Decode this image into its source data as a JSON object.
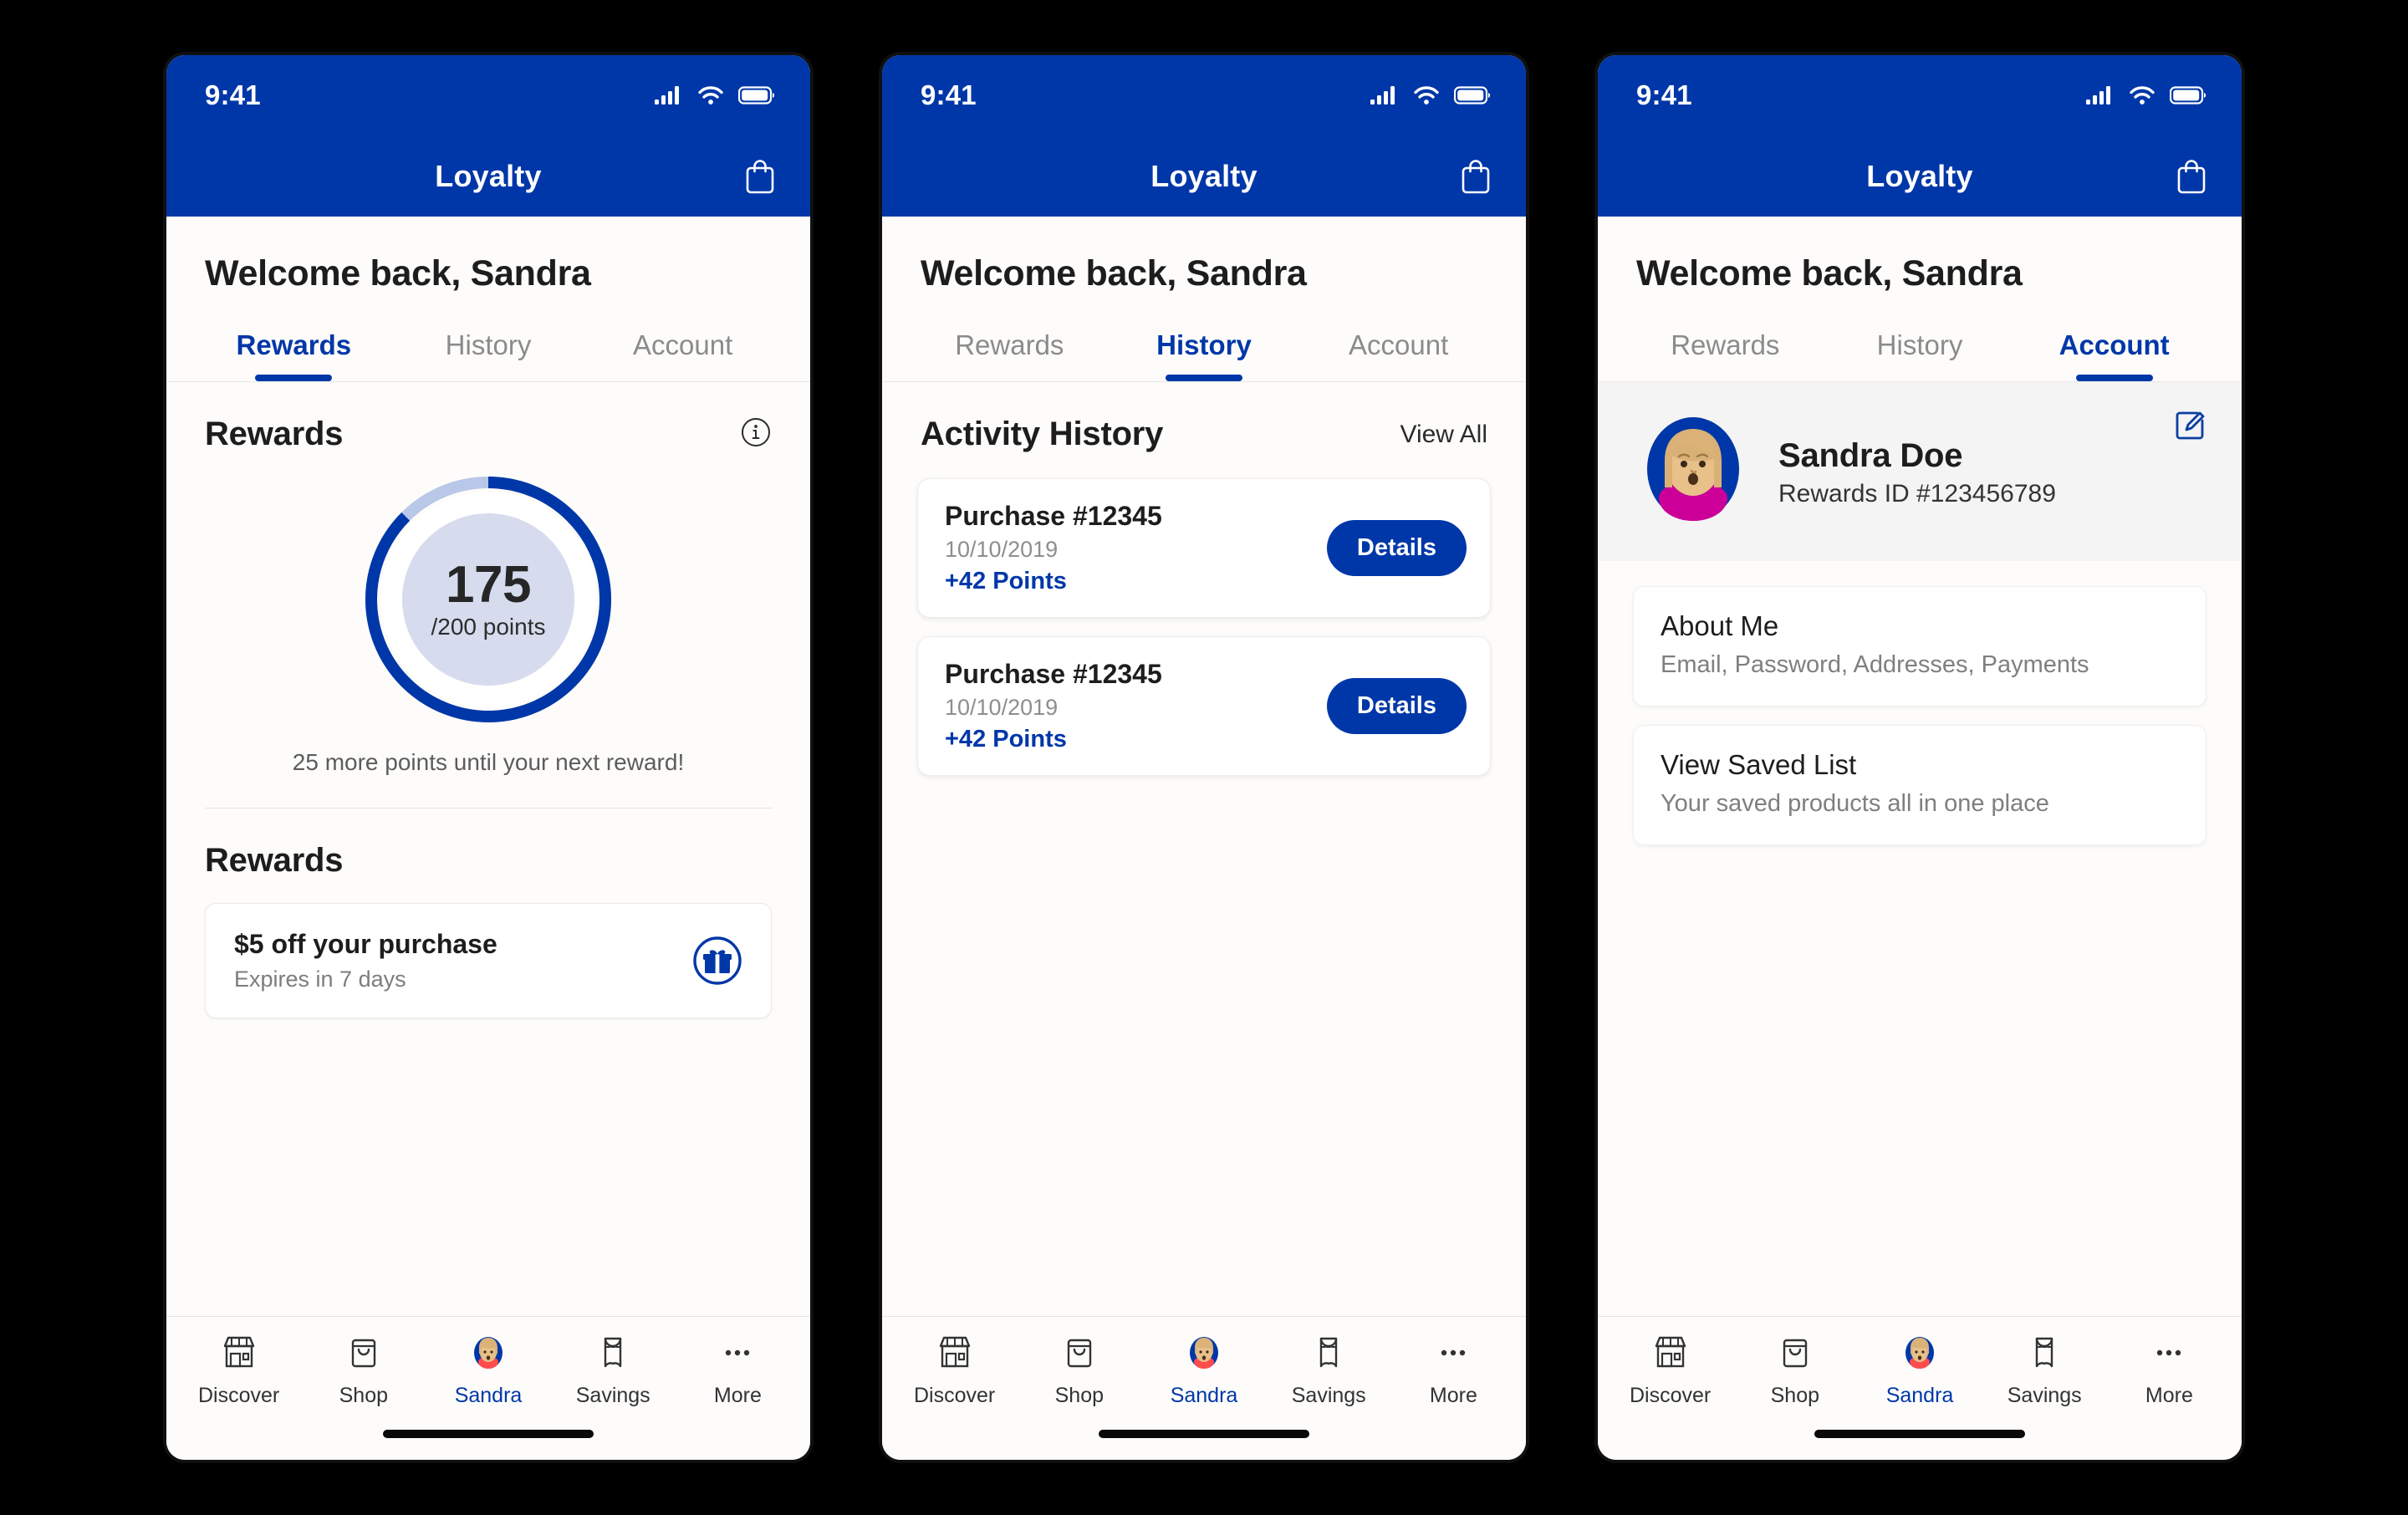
{
  "status_bar": {
    "time": "9:41",
    "icons": [
      "cellular-signal-icon",
      "wifi-icon",
      "battery-icon"
    ]
  },
  "nav": {
    "title": "Loyalty",
    "action_icon": "shopping-bag-icon"
  },
  "colors": {
    "brand_blue": "#0037a8",
    "ring_track": "#b9c7e8",
    "muted_text": "#8b8b8b",
    "avatar_shirt": "#cc0099"
  },
  "welcome": "Welcome back, Sandra",
  "segment_tabs": [
    "Rewards",
    "History",
    "Account"
  ],
  "screen1": {
    "active_tab": "Rewards",
    "section_title": "Rewards",
    "info_icon": "info-icon",
    "ring": {
      "value": "175",
      "denominator": "/200 points",
      "points": 175,
      "goal": 200,
      "percent": 87.5
    },
    "hint": "25 more points until your next reward!",
    "rewards_heading": "Rewards",
    "reward_card": {
      "title": "$5 off your purchase",
      "subtitle": "Expires in 7 days",
      "icon": "gift-icon"
    }
  },
  "screen2": {
    "active_tab": "History",
    "section_title": "Activity History",
    "view_all": "View All",
    "activities": [
      {
        "title": "Purchase #12345",
        "date": "10/10/2019",
        "points": "+42 Points",
        "button": "Details"
      },
      {
        "title": "Purchase #12345",
        "date": "10/10/2019",
        "points": "+42 Points",
        "button": "Details"
      }
    ]
  },
  "screen3": {
    "active_tab": "Account",
    "profile": {
      "name": "Sandra Doe",
      "rewards_id": "Rewards ID #123456789",
      "avatar": "user-avatar",
      "edit_icon": "edit-icon"
    },
    "cards": [
      {
        "title": "About Me",
        "subtitle": "Email, Password, Addresses, Payments"
      },
      {
        "title": "View Saved List",
        "subtitle": "Your saved products all in one place"
      }
    ]
  },
  "tabbar": {
    "items": [
      {
        "label": "Discover",
        "icon": "store-icon",
        "active": false
      },
      {
        "label": "Shop",
        "icon": "shopping-basket-icon",
        "active": false
      },
      {
        "label": "Sandra",
        "icon": "user-avatar-icon",
        "active": true
      },
      {
        "label": "Savings",
        "icon": "coupon-icon",
        "active": false
      },
      {
        "label": "More",
        "icon": "ellipsis-icon",
        "active": false
      }
    ]
  }
}
